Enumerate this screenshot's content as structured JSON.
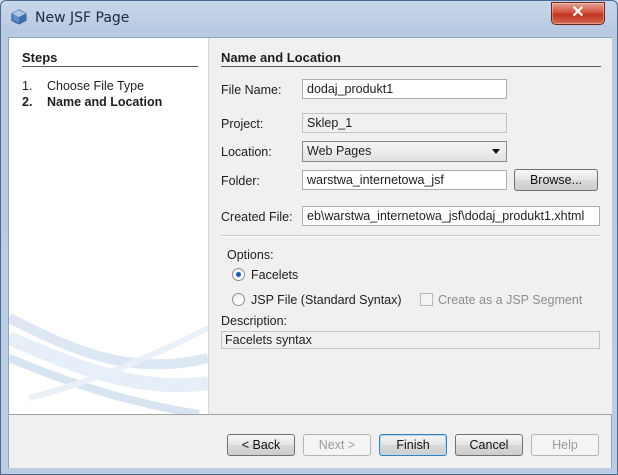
{
  "window": {
    "title": "New JSF Page",
    "close_label": "✕"
  },
  "steps": {
    "title": "Steps",
    "items": [
      {
        "num": "1.",
        "label": "Choose File Type"
      },
      {
        "num": "2.",
        "label": "Name and Location"
      }
    ]
  },
  "panel": {
    "title": "Name and Location",
    "file_name_label": "File Name:",
    "file_name_value": "dodaj_produkt1",
    "project_label": "Project:",
    "project_value": "Sklep_1",
    "location_label": "Location:",
    "location_value": "Web Pages",
    "folder_label": "Folder:",
    "folder_value": "warstwa_internetowa_jsf",
    "browse_label": "Browse...",
    "created_file_label": "Created File:",
    "created_file_value": "eb\\warstwa_internetowa_jsf\\dodaj_produkt1.xhtml",
    "options_label": "Options:",
    "facelets_label": "Facelets",
    "jsp_label": "JSP File (Standard Syntax)",
    "jsp_segment_label": "Create as a JSP Segment",
    "description_label": "Description:",
    "description_value": "Facelets syntax"
  },
  "buttons": {
    "back": "< Back",
    "next": "Next >",
    "finish": "Finish",
    "cancel": "Cancel",
    "help": "Help"
  },
  "colors": {
    "title_bar": "#bccde3",
    "close_button": "#c1341f",
    "selected_radio": "#1a5bb4"
  }
}
